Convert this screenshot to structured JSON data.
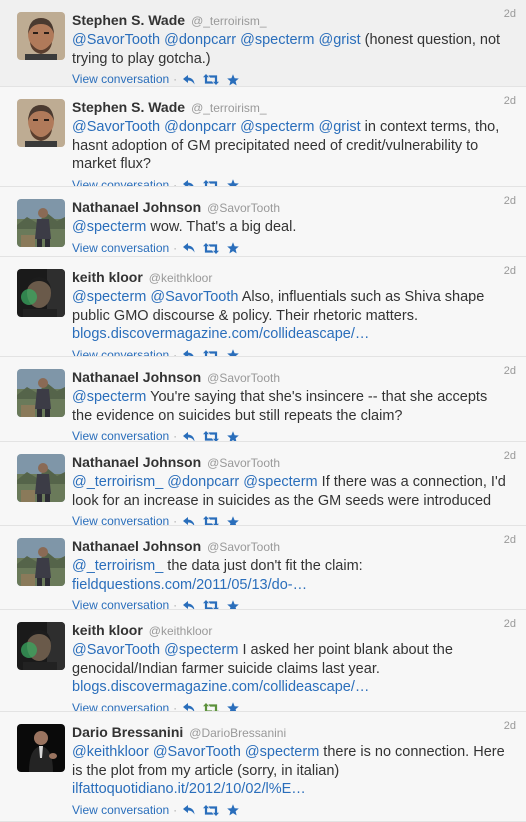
{
  "ui": {
    "view_conversation": "View conversation",
    "separator": "·"
  },
  "colors": {
    "link": "#2a6ebb",
    "icon": "#2a6ebb",
    "retweeted": "#5c913b",
    "muted": "#999999"
  },
  "icons": {
    "reply": "reply-icon",
    "retweet": "retweet-icon",
    "favorite": "favorite-star-icon"
  },
  "tweets": [
    {
      "fullname": "Stephen S. Wade",
      "username": "@_terroirism_",
      "time": "2d",
      "avatar": "stephen-wade-avatar",
      "text": "@SavorTooth @donpcarr @specterm @grist (honest question, not trying to play gotcha.)",
      "retweeted": false
    },
    {
      "fullname": "Stephen S. Wade",
      "username": "@_terroirism_",
      "time": "2d",
      "avatar": "stephen-wade-avatar",
      "text": "@SavorTooth @donpcarr @specterm @grist in context terms, tho, hasnt adoption of GM precipitated need of credit/vulnerability to market flux?",
      "retweeted": false
    },
    {
      "fullname": "Nathanael Johnson",
      "username": "@SavorTooth",
      "time": "2d",
      "avatar": "nathanael-johnson-avatar",
      "text": "@specterm wow. That's a big deal.",
      "retweeted": false
    },
    {
      "fullname": "keith kloor",
      "username": "@keithkloor",
      "time": "2d",
      "avatar": "keith-kloor-avatar",
      "text": "@specterm @SavorTooth Also, influentials such as Shiva shape public GMO discourse & policy. Their rhetoric matters. blogs.discovermagazine.com/collideascape/…",
      "retweeted": false
    },
    {
      "fullname": "Nathanael Johnson",
      "username": "@SavorTooth",
      "time": "2d",
      "avatar": "nathanael-johnson-avatar",
      "text": "@specterm You're saying that she's insincere -- that she accepts the evidence on suicides but still repeats the claim?",
      "retweeted": false
    },
    {
      "fullname": "Nathanael Johnson",
      "username": "@SavorTooth",
      "time": "2d",
      "avatar": "nathanael-johnson-avatar",
      "text": "@_terroirism_ @donpcarr @specterm If there was a connection, I'd look for an increase in suicides as the GM seeds were introduced",
      "retweeted": false
    },
    {
      "fullname": "Nathanael Johnson",
      "username": "@SavorTooth",
      "time": "2d",
      "avatar": "nathanael-johnson-avatar",
      "text": "@_terroirism_ the data just don't fit the claim: fieldquestions.com/2011/05/13/do-…",
      "retweeted": false
    },
    {
      "fullname": "keith kloor",
      "username": "@keithkloor",
      "time": "2d",
      "avatar": "keith-kloor-avatar",
      "text": "@SavorTooth @specterm I asked her point blank about the genocidal/Indian farmer suicide claims last year. blogs.discovermagazine.com/collideascape/…",
      "retweeted": true
    },
    {
      "fullname": "Dario Bressanini",
      "username": "@DarioBressanini",
      "time": "2d",
      "avatar": "dario-bressanini-avatar",
      "text": "@keithkloor @SavorTooth @specterm there is no connection. Here is the plot from my article (sorry, in italian) ilfattoquotidiano.it/2012/10/02/l%E…",
      "retweeted": false
    }
  ]
}
